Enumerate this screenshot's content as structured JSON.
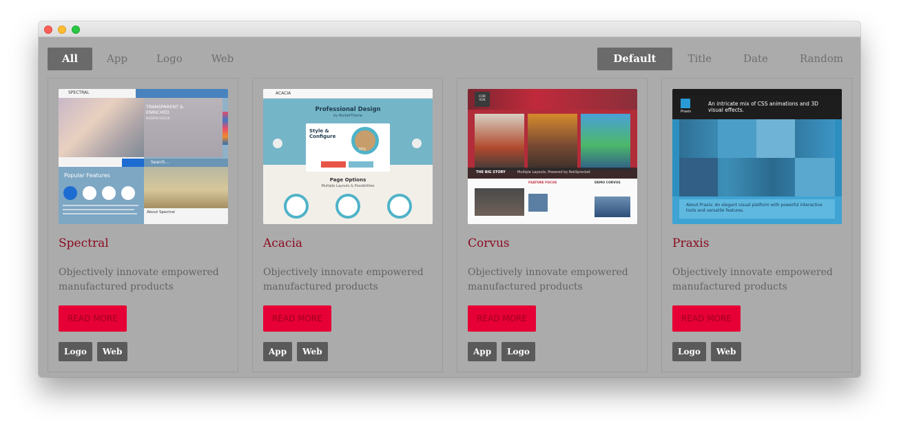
{
  "filters": [
    {
      "label": "All",
      "active": true
    },
    {
      "label": "App",
      "active": false
    },
    {
      "label": "Logo",
      "active": false
    },
    {
      "label": "Web",
      "active": false
    }
  ],
  "sorts": [
    {
      "label": "Default",
      "active": true
    },
    {
      "label": "Title",
      "active": false
    },
    {
      "label": "Date",
      "active": false
    },
    {
      "label": "Random",
      "active": false
    }
  ],
  "cards": [
    {
      "title": "Spectral",
      "description": "Objectively innovate empowered manufactured products",
      "button": "READ MORE",
      "tags": [
        "Logo",
        "Web"
      ],
      "thumb": {
        "logo": "SPECTRAL",
        "headline": "TRANSPARENT & ENRICHED",
        "sub": "MODERN DESIGN",
        "features": "Popular Features",
        "search": "Search...",
        "about": "About Spectral"
      }
    },
    {
      "title": "Acacia",
      "description": "Objectively innovate empowered manufactured products",
      "button": "READ MORE",
      "tags": [
        "App",
        "Web"
      ],
      "thumb": {
        "logo": "ACACIA",
        "headline": "Professional Design",
        "sub": "by RocketTheme",
        "box_title": "Style & Configure",
        "percent": "70%",
        "options": "Page Options",
        "options_sub": "Multiple Layouts & Possibilities"
      }
    },
    {
      "title": "Corvus",
      "description": "Objectively innovate empowered manufactured products",
      "button": "READ MORE",
      "tags": [
        "App",
        "Logo"
      ],
      "thumb": {
        "logo": "COR VUS",
        "big_story": "THE BIG STORY",
        "caption": "Multiple Layouts, Powered by RokSprocket",
        "focus": "FEATURE FOCUS",
        "demo": "DEMO CORVUS"
      }
    },
    {
      "title": "Praxis",
      "description": "Objectively innovate empowered manufactured products",
      "button": "READ MORE",
      "tags": [
        "Logo",
        "Web"
      ],
      "thumb": {
        "logo": "Praxis",
        "headline": "An intricate mix of CSS animations and 3D visual effects.",
        "about": "About Praxis: An elegant visual platform with powerful interactive tools and versatile features."
      }
    }
  ],
  "colors": {
    "accent": "#e60036",
    "title": "#8a0a1e",
    "background": "#ababab",
    "tag": "#5a5a5a"
  }
}
